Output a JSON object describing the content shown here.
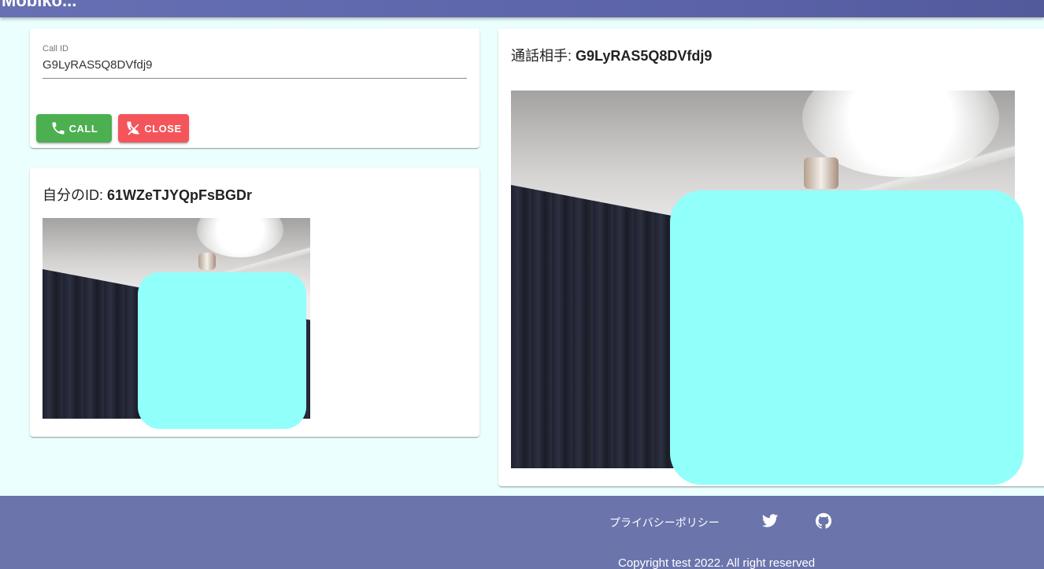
{
  "app": {
    "title": "Mobiko..."
  },
  "call_form": {
    "label": "Call ID",
    "value": "G9LyRAS5Q8DVfdj9",
    "call_button": "CALL",
    "close_button": "CLOSE",
    "call_color": "#4caf50",
    "close_color": "#f4555a"
  },
  "self_panel": {
    "heading_prefix": "自分のID: ",
    "id": "61WZeTJYQpFsBGDr"
  },
  "peer_panel": {
    "heading_prefix": "通話相手: ",
    "id": "G9LyRAS5Q8DVfdj9"
  },
  "footer": {
    "privacy": "プライバシーポリシー",
    "copyright": "Copyright test 2022. All right reserved",
    "icons": [
      "twitter-icon",
      "github-icon"
    ]
  },
  "colors": {
    "header": "#5b62a8",
    "footer": "#6b74ab",
    "background": "#ebfffe",
    "overlay": "#91fffa"
  }
}
